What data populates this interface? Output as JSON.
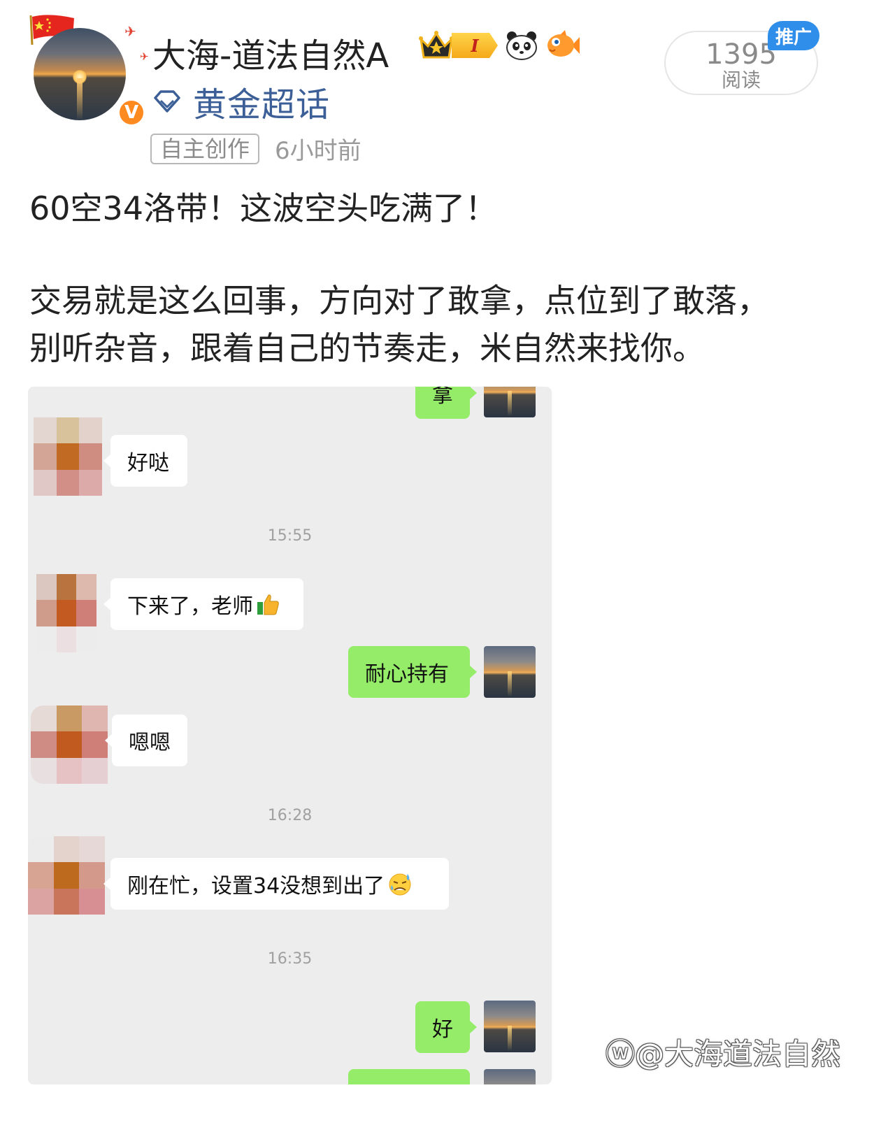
{
  "author": {
    "name": "大海-道法自然A",
    "verified_badge": "V",
    "level_badge": "I",
    "supertopic_label": "黄金超话"
  },
  "post": {
    "original_tag": "自主创作",
    "time": "6小时前",
    "title": "60空34洛带！这波空头吃满了！",
    "body_line1": "交易就是这么回事，方向对了敢拿，点位到了敢落，",
    "body_line2": "别听杂音，跟着自己的节奏走，米自然来找你。"
  },
  "stats": {
    "read_count": "1395",
    "read_label": "阅读",
    "promo_label": "推广"
  },
  "chat": {
    "messages": [
      {
        "side": "right",
        "text": "拿"
      },
      {
        "side": "left",
        "text": "好哒"
      },
      {
        "side": "time",
        "text": "15:55"
      },
      {
        "side": "left",
        "text": "下来了，老师"
      },
      {
        "side": "right",
        "text": "耐心持有"
      },
      {
        "side": "left",
        "text": "嗯嗯"
      },
      {
        "side": "time",
        "text": "16:28"
      },
      {
        "side": "left",
        "text": "刚在忙，设置34没想到出了"
      },
      {
        "side": "time",
        "text": "16:35"
      },
      {
        "side": "right",
        "text": "好"
      }
    ]
  },
  "watermark": "@大海道法自然",
  "colors": {
    "supertopic_blue": "#3b5f96",
    "chat_bg": "#ededed",
    "bubble_green": "#95ec69",
    "promo_blue": "#2f8eea",
    "vip_orange": "#ff8a1f"
  },
  "icons": [
    "china-flag-icon",
    "verified-v-icon",
    "crown-icon",
    "level-badge-icon",
    "panda-icon",
    "fish-icon",
    "diamond-icon",
    "thumbs-up-emoji",
    "sweat-emoji",
    "weibo-logo-icon"
  ]
}
